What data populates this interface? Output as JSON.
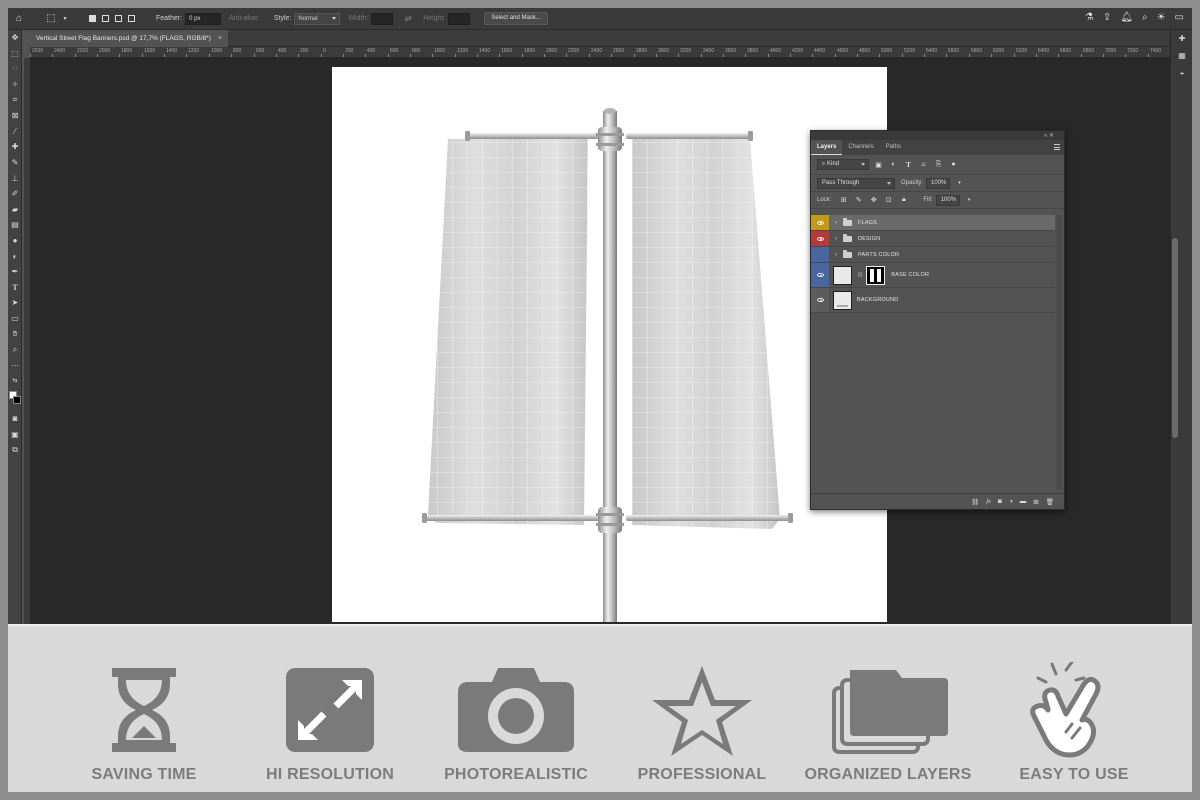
{
  "options_bar": {
    "feather_label": "Feather:",
    "feather_value": "0 px",
    "antialias_label": "Anti-alias",
    "style_label": "Style:",
    "style_value": "Normal",
    "width_label": "Width:",
    "height_label": "Height:",
    "select_mask_button": "Select and Mask..."
  },
  "document_tab": {
    "title": "Vertical Street Flag Banners.psd @ 17,7% (FLAGS, RGB/8*)",
    "close": "×"
  },
  "ruler": {
    "labels": [
      "2600",
      "2400",
      "2200",
      "2000",
      "1800",
      "1600",
      "1400",
      "1200",
      "1000",
      "800",
      "600",
      "400",
      "200",
      "0",
      "200",
      "400",
      "600",
      "800",
      "1000",
      "1200",
      "1400",
      "1600",
      "1800",
      "2000",
      "2200",
      "2400",
      "2600",
      "2800",
      "3000",
      "3200",
      "3400",
      "3600",
      "3800",
      "4000",
      "4200",
      "4400",
      "4600",
      "4800",
      "5000",
      "5200",
      "5400",
      "5600",
      "5800",
      "6000",
      "6200",
      "6400",
      "6600",
      "6800",
      "7000",
      "7200",
      "7400"
    ]
  },
  "layers_panel": {
    "tabs": [
      "Layers",
      "Channels",
      "Paths"
    ],
    "active_tab": "Layers",
    "filter_kind": "Kind",
    "blend_mode": "Pass Through",
    "opacity_label": "Opacity:",
    "opacity_value": "100%",
    "lock_label": "Lock:",
    "fill_label": "Fill:",
    "fill_value": "100%",
    "layers": [
      {
        "name": "FLAGS",
        "type": "group",
        "color": "#c19a1a",
        "visible": true,
        "selected": true
      },
      {
        "name": "DESIGN",
        "type": "group",
        "color": "#b53a3a",
        "visible": true,
        "selected": false
      },
      {
        "name": "PARTS COLOR",
        "type": "group",
        "color": "#4a66a0",
        "visible": false,
        "selected": false
      },
      {
        "name": "BASE COLOR",
        "type": "layer-with-mask",
        "color": "#4a66a0",
        "visible": true,
        "selected": false
      },
      {
        "name": "BACKGROUND",
        "type": "layer",
        "color": "",
        "visible": true,
        "selected": false
      }
    ],
    "footer_icons": [
      "link-icon",
      "fx-icon",
      "mask-icon",
      "adjustment-icon",
      "folder-icon",
      "new-layer-icon",
      "trash-icon"
    ]
  },
  "features": [
    {
      "label": "SAVING TIME",
      "icon": "hourglass-icon"
    },
    {
      "label": "HI RESOLUTION",
      "icon": "expand-icon"
    },
    {
      "label": "PHOTOREALISTIC",
      "icon": "camera-icon"
    },
    {
      "label": "PROFESSIONAL",
      "icon": "star-icon"
    },
    {
      "label": "ORGANIZED LAYERS",
      "icon": "layers-folder-icon"
    },
    {
      "label": "EASY TO USE",
      "icon": "tap-hand-icon"
    }
  ],
  "colors": {
    "feature_icon": "#7a7a7a",
    "feature_strip": "#d9d9d9",
    "canvas_bg": "#282828"
  }
}
